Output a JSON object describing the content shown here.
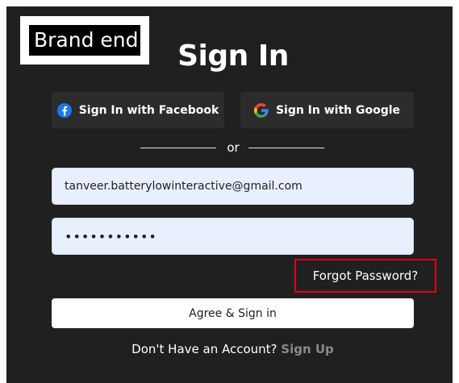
{
  "brand": {
    "text": "Brand end"
  },
  "title": "Sign In",
  "social": {
    "facebook_label": "Sign In with Facebook",
    "google_label": "Sign In with Google",
    "facebook_color": "#1877f2"
  },
  "divider": {
    "text": "or"
  },
  "form": {
    "email_value": "tanveer.batterylowinteractive@gmail.com",
    "password_value": "•••••••••••",
    "forgot_label": "Forgot Password?",
    "submit_label": "Agree & Sign in"
  },
  "footer": {
    "prompt": "Don't Have an Account? ",
    "signup_label": "Sign Up"
  },
  "colors": {
    "background": "#202020",
    "field_bg": "#e8f0fe",
    "highlight_border": "#e0000f"
  }
}
